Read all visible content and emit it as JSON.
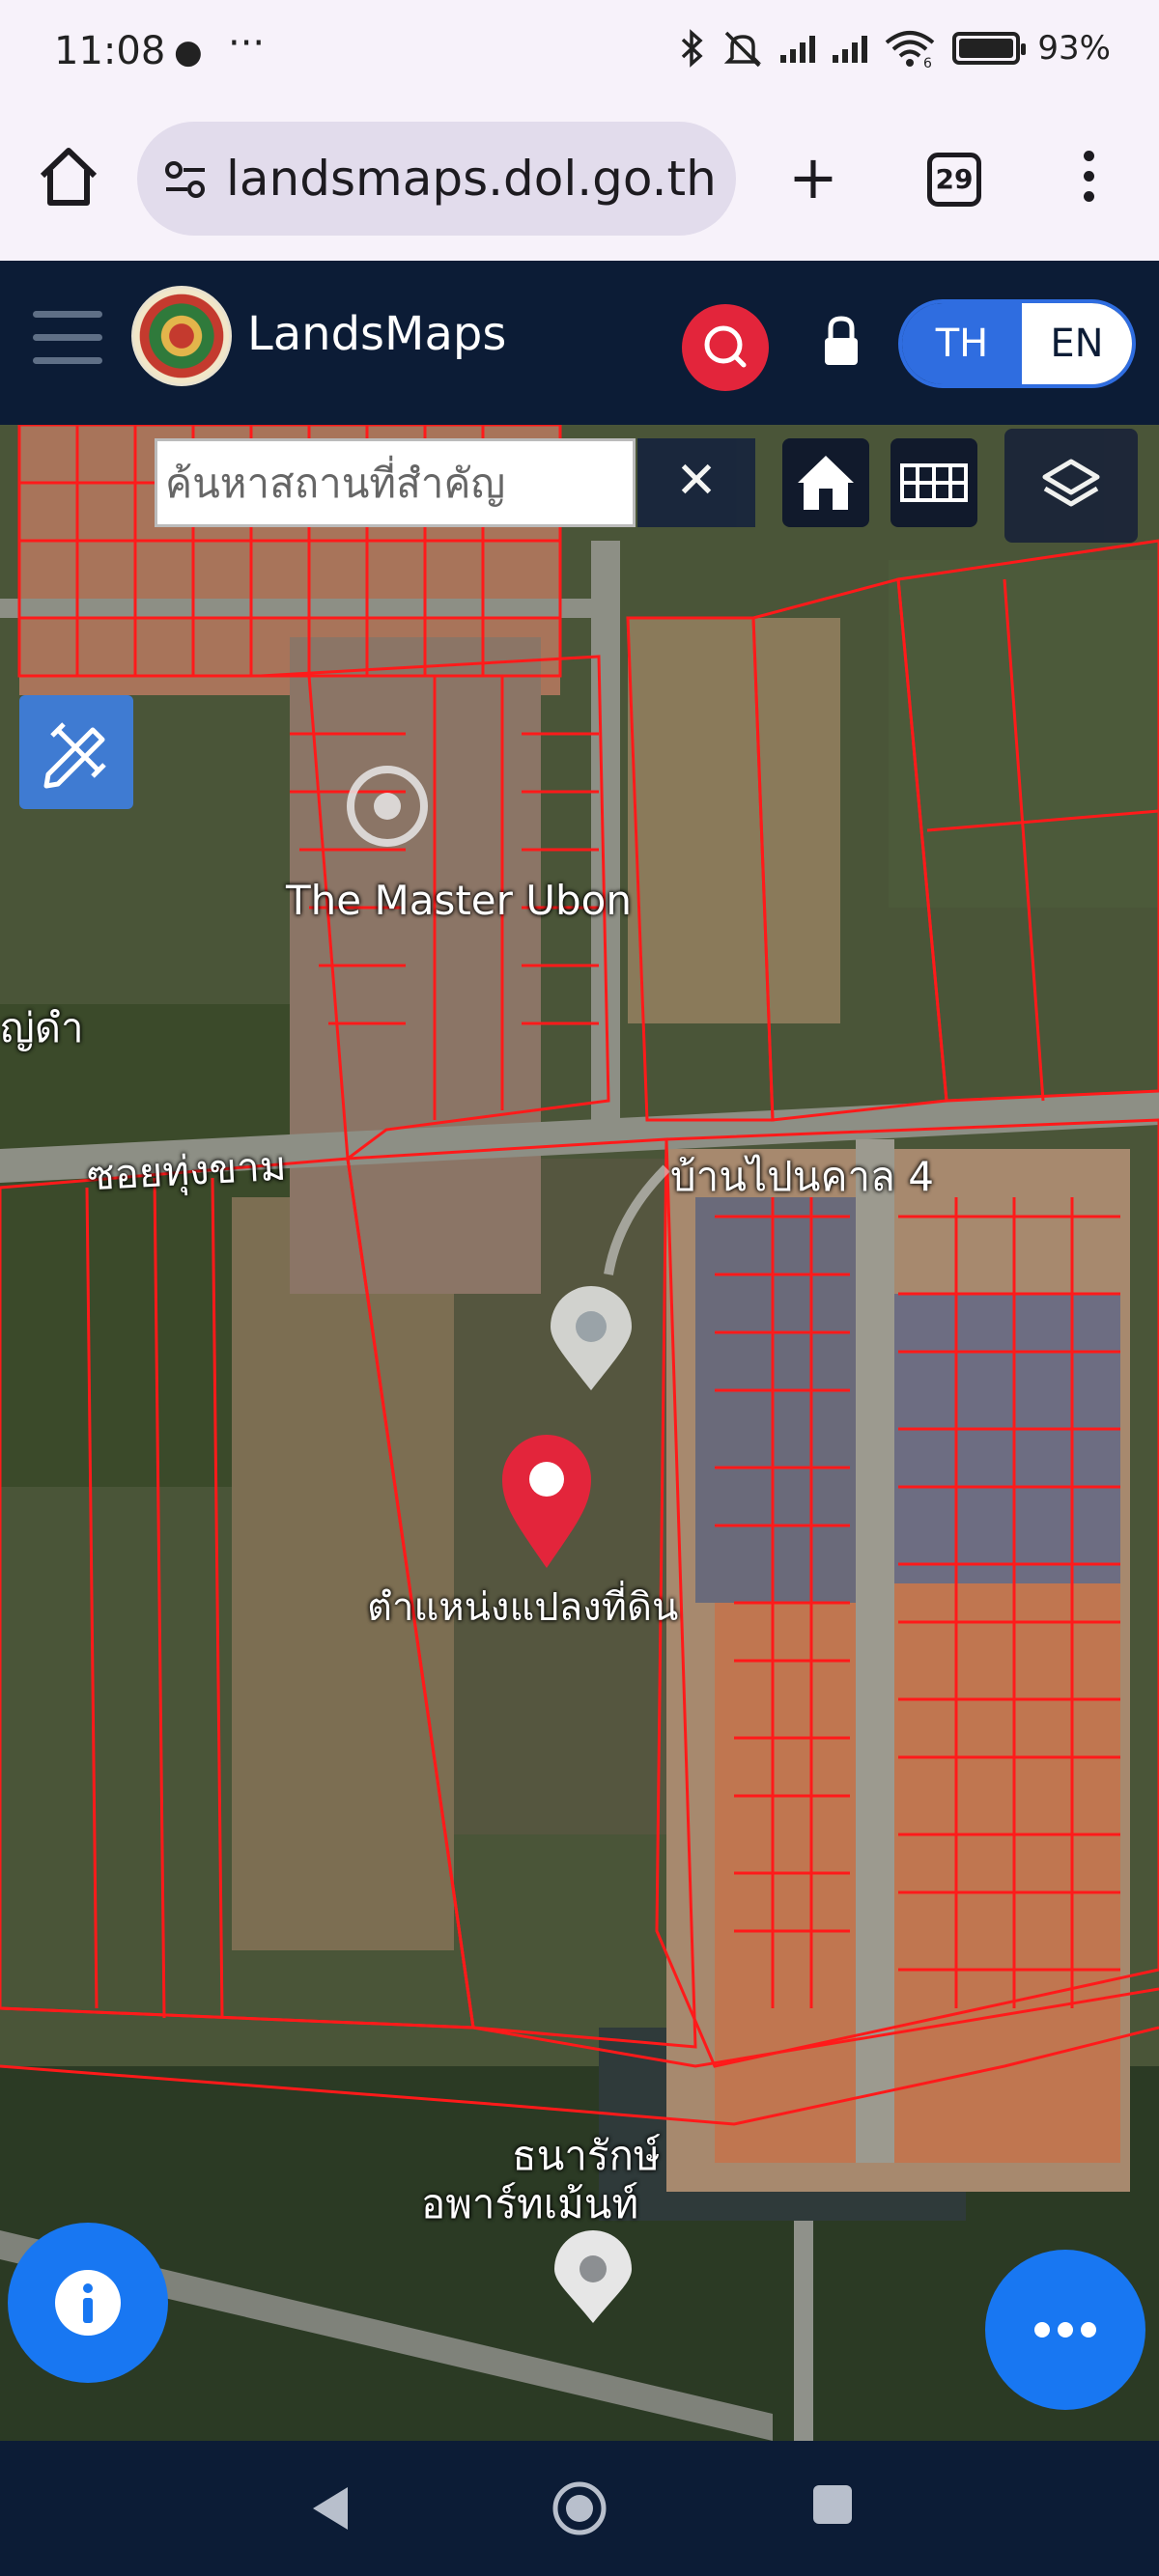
{
  "status_bar": {
    "time": "11:08",
    "notification_icon": "chat-bubble-icon",
    "more": "···",
    "battery": "93%",
    "network_badge": "6"
  },
  "browser": {
    "url": "landsmaps.dol.go.th",
    "tab_count": "29"
  },
  "app": {
    "name": "LandsMaps",
    "lang_th": "TH",
    "lang_en": "EN",
    "accent": "#e3253b",
    "header_bg": "#0c1c36",
    "lang_active_color": "#2f6de0"
  },
  "map": {
    "search_placeholder": "ค้นหาสถานที่สำคัญ",
    "clear": "✕",
    "labels": {
      "master_ubon": "The Master Ubon",
      "soi": "ซอยทุ่งขาม",
      "village": "บ้านไปนคาล 4",
      "left_edge": "ญ่ดำ",
      "land_position": "ตำแหน่งแปลงที่ดิน",
      "apartment_line1": "ธนารักษ์",
      "apartment_line2": "อพาร์ทเม้นท์"
    },
    "parcel_line_color": "#ff1a1a",
    "pin_color": "#e3253b",
    "fab_color": "#1877f2"
  }
}
